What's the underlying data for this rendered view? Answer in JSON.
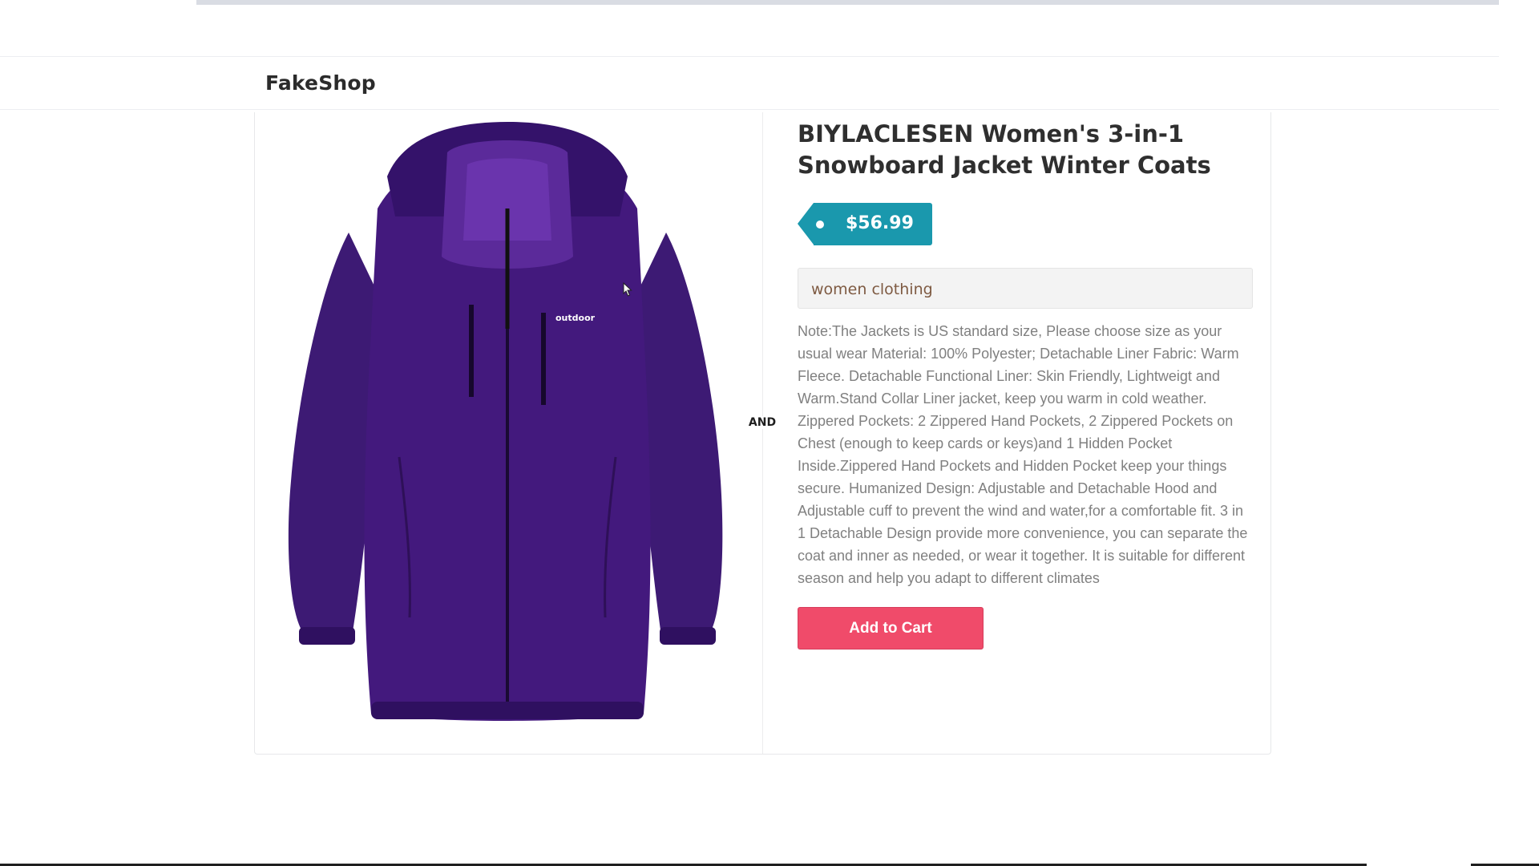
{
  "navbar": {
    "brand": "FakeShop"
  },
  "product": {
    "title": "BIYLACLESEN Women's 3-in-1 Snowboard Jacket Winter Coats",
    "price": "$56.99",
    "category": "women clothing",
    "description": "Note:The Jackets is US standard size, Please choose size as your usual wear Material: 100% Polyester; Detachable Liner Fabric: Warm Fleece. Detachable Functional Liner: Skin Friendly, Lightweigt and Warm.Stand Collar Liner jacket, keep you warm in cold weather. Zippered Pockets: 2 Zippered Hand Pockets, 2 Zippered Pockets on Chest (enough to keep cards or keys)and 1 Hidden Pocket Inside.Zippered Hand Pockets and Hidden Pocket keep your things secure. Humanized Design: Adjustable and Detachable Hood and Adjustable cuff to prevent the wind and water,for a comfortable fit. 3 in 1 Detachable Design provide more convenience, you can separate the coat and inner as needed, or wear it together. It is suitable for different season and help you adapt to different climates",
    "image_logo_text": "outdoor",
    "add_to_cart_label": "Add to Cart"
  },
  "divider_label": "AND",
  "colors": {
    "price_tag": "#1a98ad",
    "add_to_cart": "#f04b6a",
    "category_text": "#7e5a42",
    "jacket": "#3f1a78"
  }
}
